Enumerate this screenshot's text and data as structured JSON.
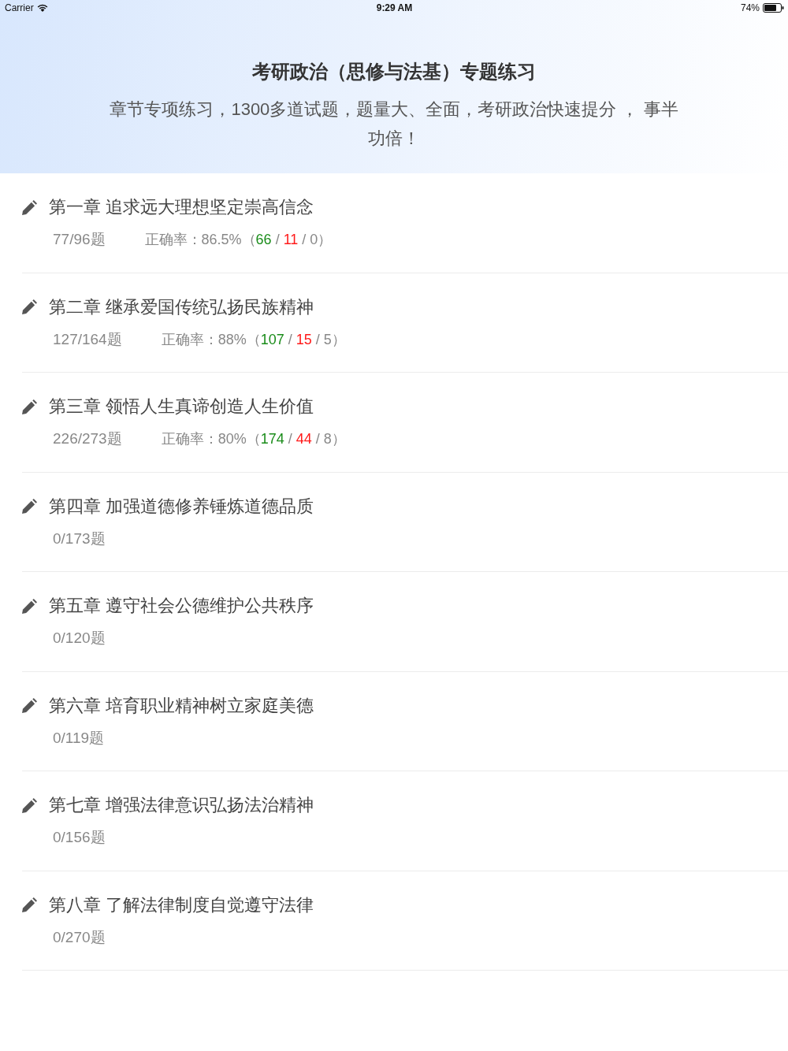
{
  "status_bar": {
    "carrier": "Carrier",
    "time": "9:29 AM",
    "battery": "74%"
  },
  "header": {
    "title": "考研政治（思修与法基）专题练习",
    "subtitle": "章节专项练习，1300多道试题，题量大、全面，考研政治快速提分 ， 事半功倍！"
  },
  "chapters": [
    {
      "title": "第一章 追求远大理想坚定崇高信念",
      "progress": "77/96题",
      "accuracy": [
        {
          "text": "正确率：86.5%（"
        },
        {
          "text": "66",
          "color": "#1a8c1a"
        },
        {
          "text": " / "
        },
        {
          "text": "11",
          "color": "#ff1a1a"
        },
        {
          "text": " / 0）"
        }
      ]
    },
    {
      "title": "第二章 继承爱国传统弘扬民族精神",
      "progress": "127/164题",
      "accuracy": [
        {
          "text": "正确率：88%（"
        },
        {
          "text": "107",
          "color": "#1a8c1a"
        },
        {
          "text": " / "
        },
        {
          "text": "15",
          "color": "#ff1a1a"
        },
        {
          "text": " / 5）"
        }
      ]
    },
    {
      "title": "第三章 领悟人生真谛创造人生价值",
      "progress": "226/273题",
      "accuracy": [
        {
          "text": "正确率：80%（"
        },
        {
          "text": "174",
          "color": "#1a8c1a"
        },
        {
          "text": " / "
        },
        {
          "text": "44",
          "color": "#ff1a1a"
        },
        {
          "text": " / 8）"
        }
      ]
    },
    {
      "title": "第四章 加强道德修养锤炼道德品质",
      "progress": "0/173题"
    },
    {
      "title": "第五章 遵守社会公德维护公共秩序",
      "progress": "0/120题"
    },
    {
      "title": "第六章 培育职业精神树立家庭美德",
      "progress": "0/119题"
    },
    {
      "title": "第七章 增强法律意识弘扬法治精神",
      "progress": "0/156题"
    },
    {
      "title": "第八章 了解法律制度自觉遵守法律",
      "progress": "0/270题"
    }
  ]
}
